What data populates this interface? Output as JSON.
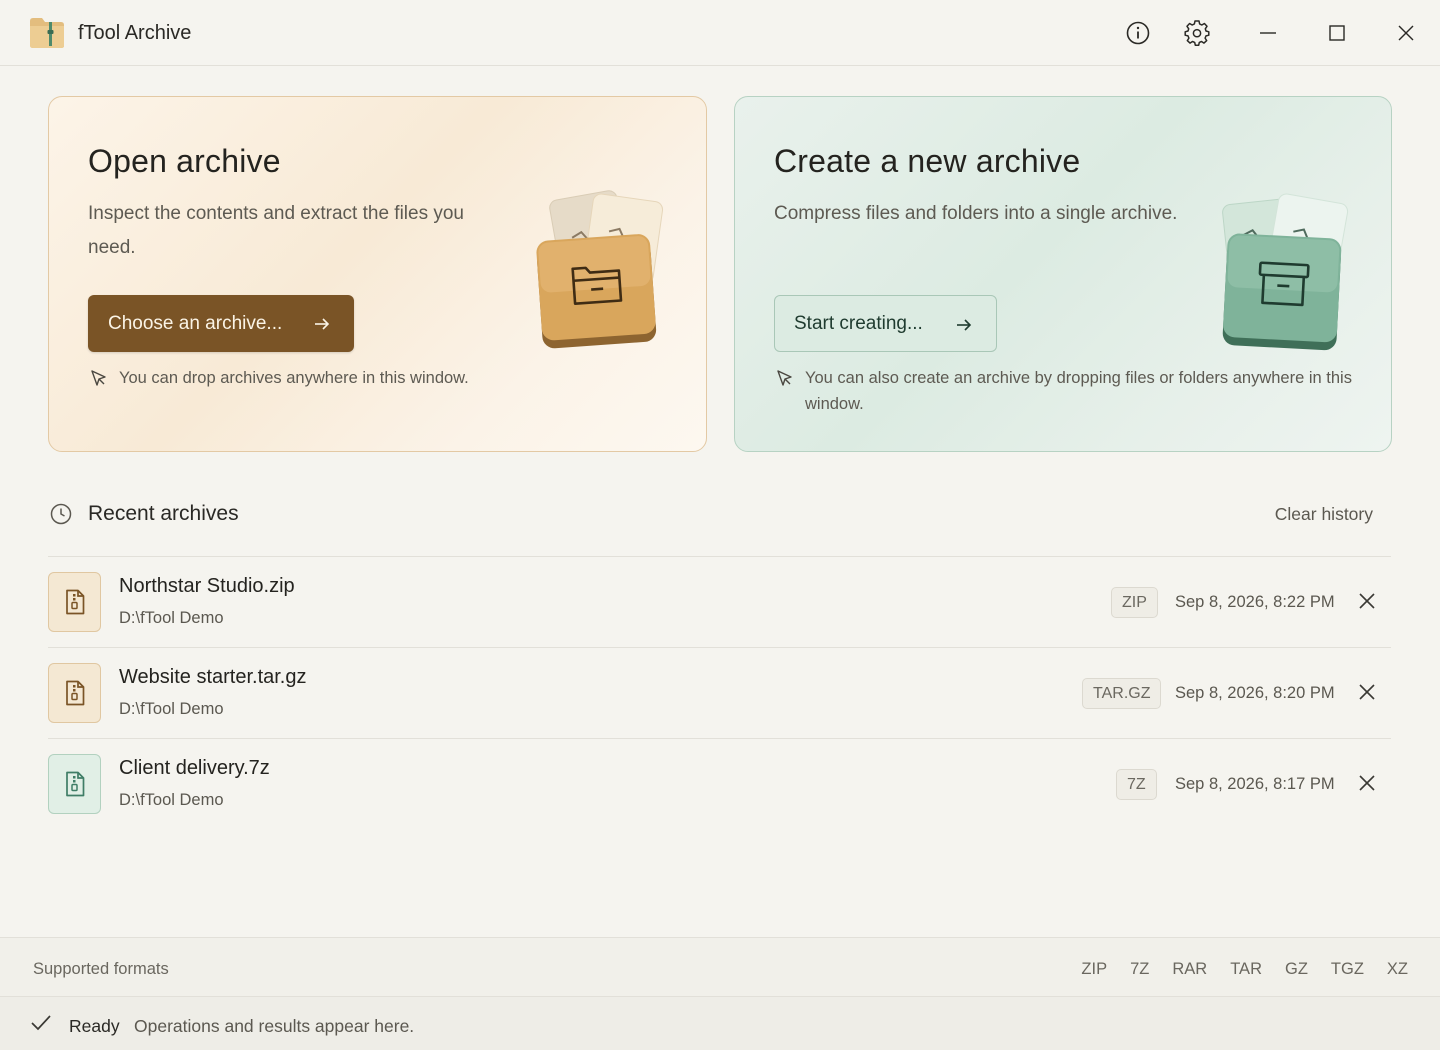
{
  "app": {
    "title": "fTool Archive"
  },
  "open_card": {
    "title": "Open archive",
    "description": "Inspect the contents and extract the files you need.",
    "button_label": "Choose an archive...",
    "hint": "You can drop archives anywhere in this window."
  },
  "create_card": {
    "title": "Create a new archive",
    "description": "Compress files and folders into a single archive.",
    "button_label": "Start creating...",
    "hint": "You can also create an archive by dropping files or folders anywhere in this window."
  },
  "recent": {
    "title": "Recent archives",
    "clear_label": "Clear history",
    "items": [
      {
        "name": "Northstar Studio.zip",
        "path": "D:\\fTool Demo",
        "type": "ZIP",
        "date": "Sep 8, 2026, 8:22 PM"
      },
      {
        "name": "Website starter.tar.gz",
        "path": "D:\\fTool Demo",
        "type": "TAR.GZ",
        "date": "Sep 8, 2026, 8:20 PM"
      },
      {
        "name": "Client delivery.7z",
        "path": "D:\\fTool Demo",
        "type": "7Z",
        "date": "Sep 8, 2026, 8:17 PM"
      }
    ]
  },
  "formats": {
    "label": "Supported formats",
    "list": [
      "ZIP",
      "7Z",
      "RAR",
      "TAR",
      "GZ",
      "TGZ",
      "XZ"
    ]
  },
  "status": {
    "state": "Ready",
    "message": "Operations and results appear here."
  },
  "colors": {
    "accent_brown": "#7a5426",
    "accent_green": "#3f7d66",
    "background": "#f5f4ef"
  }
}
